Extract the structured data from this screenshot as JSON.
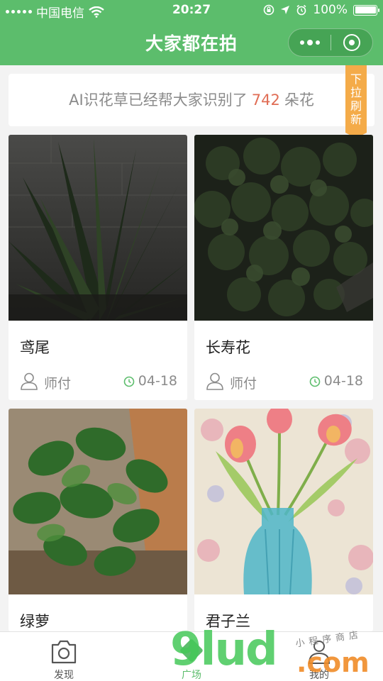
{
  "status_bar": {
    "carrier": "中国电信",
    "time": "20:27",
    "battery": "100%"
  },
  "nav": {
    "title": "大家都在拍"
  },
  "banner": {
    "prefix": "AI识花草已经帮大家识别了",
    "count": "742",
    "suffix": "朵花"
  },
  "pull_refresh": {
    "label": "下拉刷新"
  },
  "cards": [
    {
      "name": "鸢尾",
      "user": "师付",
      "date": "04-18"
    },
    {
      "name": "长寿花",
      "user": "师付",
      "date": "04-18"
    },
    {
      "name": "绿萝"
    },
    {
      "name": "君子兰"
    }
  ],
  "tabbar": {
    "items": [
      {
        "label": "发现",
        "icon": "camera-icon"
      },
      {
        "label": "广场",
        "icon": "square-icon"
      },
      {
        "label": "我的",
        "icon": "user-icon"
      }
    ]
  },
  "watermark": {
    "logo": "9lud",
    "domain": ".com",
    "sub": "小程序商店"
  },
  "colors": {
    "brand_green": "#5cbd6c",
    "count_red": "#e06d55",
    "pull_orange": "#f4ab49"
  }
}
